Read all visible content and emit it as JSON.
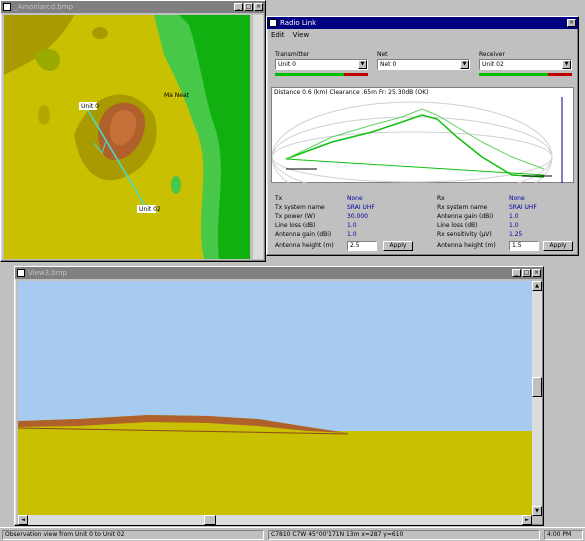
{
  "map_window": {
    "title": "_Amoniarcd.bmp",
    "labels": {
      "unit_a": "Unit 0",
      "unit_b": "Unit 02",
      "waypoint": "Ma Neat"
    }
  },
  "radio_window": {
    "title": "Radio Link",
    "menu": [
      "Edit",
      "View"
    ],
    "transmitter_label": "Transmitter",
    "net_label": "Net",
    "receiver_label": "Receiver",
    "transmitter_value": "Unit 0",
    "net_value": "Net 0",
    "receiver_value": "Unit 02",
    "profile_header": "Distance 0.6 (km)  Clearance .65m  Fr: 25.30dB  (OK)",
    "left": {
      "role": "Tx",
      "role_value": "None",
      "rows": [
        {
          "label": "Tx system name",
          "value": "SRAI UHF"
        },
        {
          "label": "Tx power (W)",
          "value": "30.000"
        },
        {
          "label": "Line loss (dB)",
          "value": "1.0"
        },
        {
          "label": "Antenna gain (dBi)",
          "value": "1.0"
        },
        {
          "label": "Antenna height (m)",
          "value": ""
        }
      ],
      "height_input": "2.5",
      "apply": "Apply"
    },
    "right": {
      "role": "Rx",
      "role_value": "None",
      "rows": [
        {
          "label": "Rx system name",
          "value": "SRAI UHF"
        },
        {
          "label": "Antenna gain (dBi)",
          "value": "1.0"
        },
        {
          "label": "Line loss (dB)",
          "value": "1.0"
        },
        {
          "label": "Rx sensitivity (μV)",
          "value": "1.25"
        },
        {
          "label": "Antenna height (m)",
          "value": ""
        }
      ],
      "height_input": "1.5",
      "apply": "Apply"
    }
  },
  "view_window": {
    "title": "View3.bmp"
  },
  "statusbar": {
    "left": "Observation view from Unit 0 to Unit 02",
    "middle": "C7810  C7W  45°00'171N  13m  x=287 y=610",
    "time": "4:00 PM"
  },
  "colors": {
    "titlebar_active": "#000080",
    "titlebar_inactive": "#808080",
    "sky": "#a6caf0",
    "ground": "#c8c000",
    "ridge": "#b0602a"
  }
}
